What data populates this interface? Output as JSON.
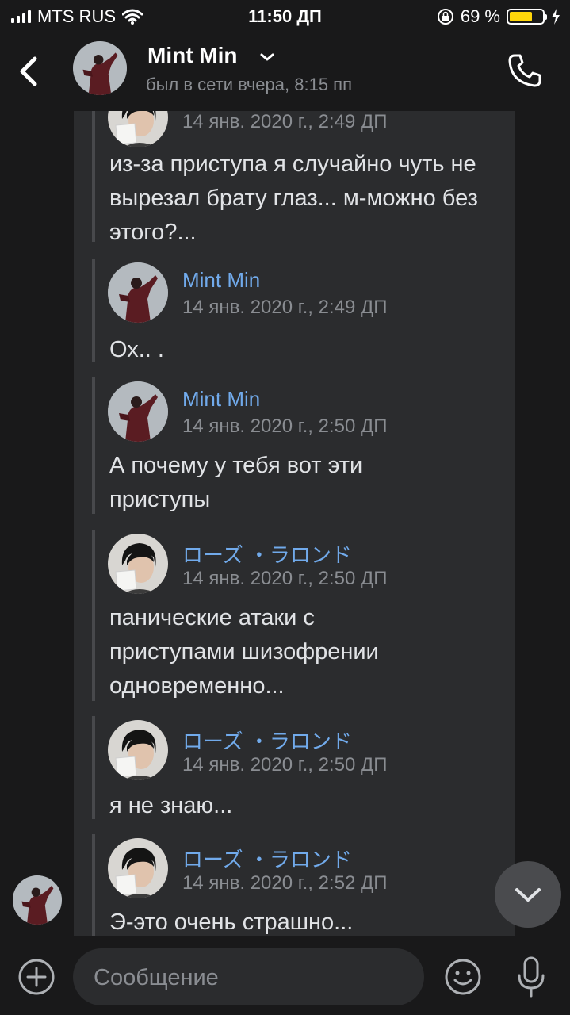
{
  "status_bar": {
    "carrier": "MTS RUS",
    "time": "11:50 ДП",
    "battery_percent": "69 %",
    "battery_level": 0.69
  },
  "header": {
    "name": "Mint Min",
    "status": "был в сети вчера, 8:15 пп"
  },
  "messages": [
    {
      "author": "",
      "date": "14 янв. 2020 г., 2:49 ДП",
      "text": "из-за приступа я случайно чуть не вырезал брату глаз... м-можно без этого?...",
      "avatar": "rose-avatar"
    },
    {
      "author": "Mint Min",
      "date": "14 янв. 2020 г., 2:49 ДП",
      "text": "Ох.. .",
      "avatar": "mint-avatar"
    },
    {
      "author": "Mint Min",
      "date": "14 янв. 2020 г., 2:50 ДП",
      "text": "А почему у тебя вот эти приступы",
      "avatar": "mint-avatar"
    },
    {
      "author": "ローズ ・ラロンド",
      "date": "14 янв. 2020 г., 2:50 ДП",
      "text": "панические атаки с приступами шизофрении одновременно...",
      "avatar": "rose-avatar"
    },
    {
      "author": "ローズ ・ラロンド",
      "date": "14 янв. 2020 г., 2:50 ДП",
      "text": "я не знаю...",
      "avatar": "rose-avatar"
    },
    {
      "author": "ローズ ・ラロンド",
      "date": "14 янв. 2020 г., 2:52 ДП",
      "text": "Э-это очень страшно...",
      "avatar": "rose-avatar"
    }
  ],
  "composer": {
    "placeholder": "Сообщение"
  },
  "icons": [
    "back-chevron-icon",
    "dropdown-chevron-icon",
    "phone-icon",
    "scroll-down-icon",
    "add-icon",
    "emoji-icon",
    "microphone-icon",
    "wifi-icon",
    "orientation-lock-icon",
    "charging-icon"
  ],
  "colors": {
    "background": "#19191a",
    "panel": "#2b2c2e",
    "author_link": "#71aaeb",
    "muted": "#8a8d92",
    "battery": "#ffd60a"
  }
}
